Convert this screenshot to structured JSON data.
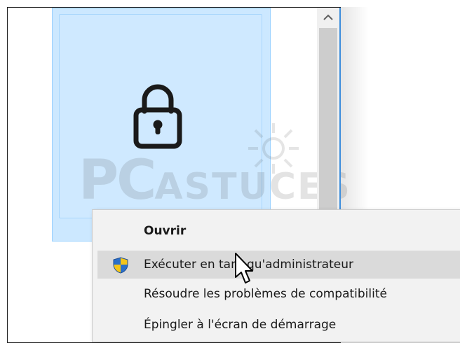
{
  "explorer": {
    "tile_icon": "lock-icon",
    "watermark_text_a": "PC",
    "watermark_text_b": "ASTUCES",
    "scroll_up_glyph": "^"
  },
  "context_menu": {
    "items": [
      {
        "label": "Ouvrir",
        "bold": true,
        "icon": ""
      },
      {
        "label": "Exécuter en tant qu'administrateur",
        "bold": false,
        "icon": "uac-shield-icon",
        "hovered": true
      },
      {
        "label": "Résoudre les problèmes de compatibilité",
        "bold": false,
        "icon": ""
      },
      {
        "label": "Épingler à l'écran de démarrage",
        "bold": false,
        "icon": ""
      }
    ]
  },
  "colors": {
    "selection_fill": "#cce8ff",
    "selection_border": "#99d1ff",
    "menu_bg": "#f2f2f2",
    "menu_hover": "#dadada",
    "shield_blue": "#2a6fc9",
    "shield_yellow": "#f5c518"
  }
}
